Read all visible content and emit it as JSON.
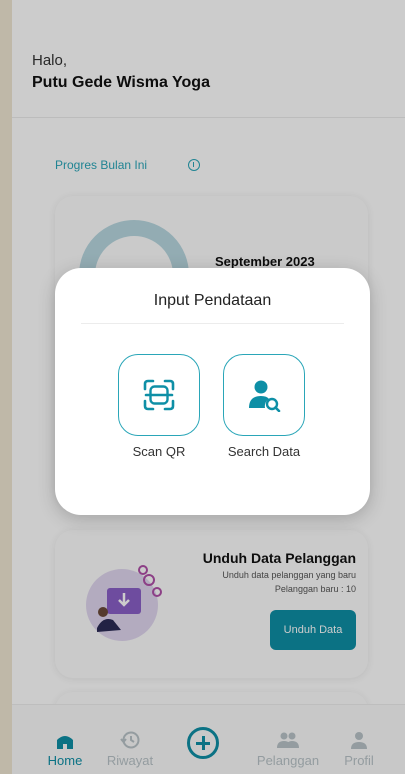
{
  "header": {
    "greeting": "Halo,",
    "user_name": "Putu Gede Wisma Yoga"
  },
  "progress": {
    "title": "Progres Bulan Ini",
    "month": "September 2023"
  },
  "download_card": {
    "title": "Unduh Data Pelanggan",
    "description": "Unduh data pelanggan yang baru",
    "new_customers": "Pelanggan baru : 10",
    "button_label": "Unduh Data"
  },
  "modal": {
    "title": "Input Pendataan",
    "options": [
      {
        "label": "Scan QR",
        "icon": "qr-scan-icon"
      },
      {
        "label": "Search Data",
        "icon": "user-search-icon"
      }
    ]
  },
  "bottom_nav": {
    "items": [
      {
        "label": "Home",
        "icon": "home-icon",
        "active": true
      },
      {
        "label": "Riwayat",
        "icon": "history-icon",
        "active": false
      },
      {
        "label": "",
        "icon": "add-circle-icon",
        "active": false
      },
      {
        "label": "Pelanggan",
        "icon": "people-icon",
        "active": false
      },
      {
        "label": "Profil",
        "icon": "person-icon",
        "active": false
      }
    ]
  },
  "colors": {
    "accent": "#0e8fa6",
    "accent_light": "#2aa6b8",
    "inactive": "#b9c4c8"
  }
}
